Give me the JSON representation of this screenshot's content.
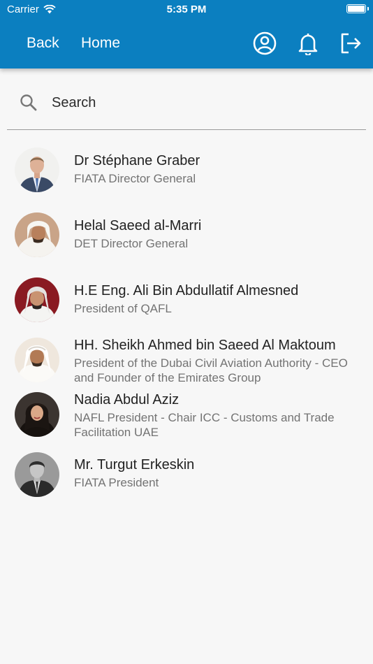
{
  "status_bar": {
    "carrier": "Carrier",
    "time": "5:35 PM"
  },
  "header": {
    "back_label": "Back",
    "home_label": "Home",
    "icons": [
      "profile-icon",
      "bell-icon",
      "logout-icon"
    ],
    "background": "#0b7fc0"
  },
  "search": {
    "placeholder": "Search",
    "value": ""
  },
  "speakers": [
    {
      "name": "Dr Stéphane Graber",
      "title": "FIATA Director General"
    },
    {
      "name": "Helal Saeed al-Marri",
      "title": "DET Director General"
    },
    {
      "name": "H.E Eng. Ali Bin Abdullatif Almesned",
      "title": "President of QAFL"
    },
    {
      "name": "HH. Sheikh Ahmed bin Saeed Al Maktoum",
      "title": "President of the Dubai Civil Aviation Authority - CEO and Founder of the Emirates Group"
    },
    {
      "name": "Nadia Abdul Aziz",
      "title": "NAFL President - Chair ICC - Customs and Trade Facilitation UAE"
    },
    {
      "name": "Mr. Turgut Erkeskin",
      "title": "FIATA President"
    }
  ]
}
